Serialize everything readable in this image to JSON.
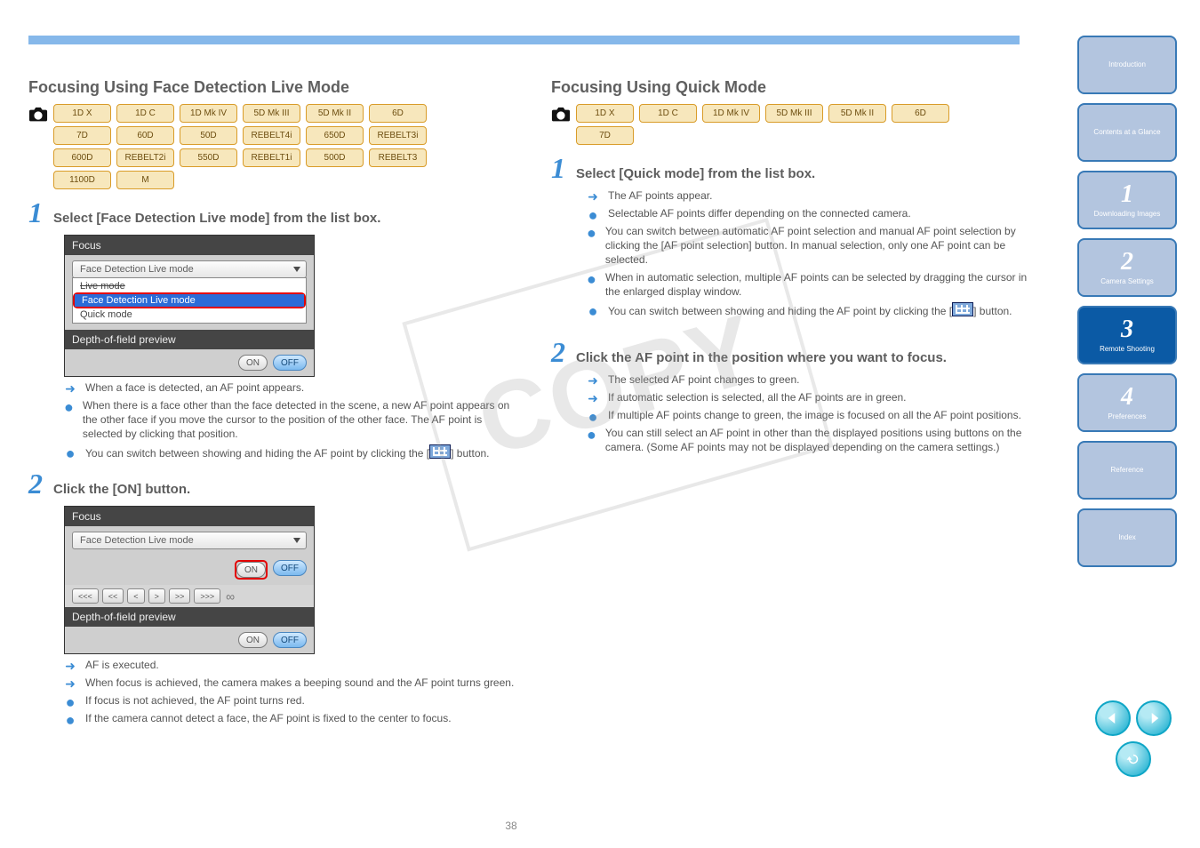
{
  "watermark": "COPY",
  "page_number": "38",
  "top_sidebar": [
    {
      "label": "Introduction"
    },
    {
      "label": "Contents at a Glance"
    },
    {
      "num": "1",
      "label": "Downloading Images"
    },
    {
      "num": "2",
      "label": "Camera Settings"
    },
    {
      "num": "3",
      "label": "Remote Shooting",
      "active": true
    },
    {
      "num": "4",
      "label": "Preferences"
    },
    {
      "label": "Reference"
    },
    {
      "label": "Index"
    }
  ],
  "left": {
    "title": "Focusing Using Face Detection Live Mode",
    "modes": [
      "1D X",
      "1D C",
      "1D Mk IV",
      "5D Mk III",
      "5D Mk II",
      "6D",
      "7D",
      "60D",
      "50D",
      "REBELT4i",
      "650D",
      "REBELT3i",
      "600D",
      "REBELT2i",
      "550D",
      "REBELT1i",
      "500D",
      "REBELT3",
      "1100D",
      "M"
    ],
    "step1": {
      "num": "1",
      "text": "Select [Face Detection Live mode] from the list box.",
      "ui": {
        "head": "Focus",
        "select_value": "Face Detection Live mode",
        "options": [
          "Live mode",
          "Face Detection Live mode",
          "Quick mode"
        ],
        "subhead": "Depth-of-field preview",
        "on": "ON",
        "off": "OFF"
      },
      "arrow1": "When a face is detected, an AF point appears.",
      "bullet1": "When there is a face other than the face detected in the scene, a new AF point appears on the other face if you move the cursor to the position of the other face. The AF point is selected by clicking that position.",
      "bullet2_a": "You can switch between showing and hiding the AF point by clicking the [",
      "bullet2_b": "] button."
    },
    "step2": {
      "num": "2",
      "text": "Click the [ON] button.",
      "ui": {
        "head": "Focus",
        "select_value": "Face Detection Live mode",
        "on": "ON",
        "off": "OFF",
        "nav": [
          "<<<",
          "<<",
          "<",
          ">",
          ">>",
          ">>>"
        ],
        "inf": "∞",
        "subhead": "Depth-of-field preview"
      },
      "arrow1": "AF is executed.",
      "arrow2": "When focus is achieved, the camera makes a beeping sound and the AF point turns green.",
      "bullet1": "If focus is not achieved, the AF point turns red.",
      "bullet2": "If the camera cannot detect a face, the AF point is fixed to the center to focus."
    }
  },
  "right": {
    "title": "Focusing Using Quick Mode",
    "modes": [
      "1D X",
      "1D C",
      "1D Mk IV",
      "5D Mk III",
      "5D Mk II",
      "6D",
      "7D"
    ],
    "step1": {
      "num": "1",
      "text": "Select [Quick mode] from the list box.",
      "arrow1": "The AF points appear.",
      "bullet1": "Selectable AF points differ depending on the connected camera.",
      "bullet2": "You can switch between automatic AF point selection and manual AF point selection by clicking the [AF point selection] button. In manual selection, only one AF point can be selected.",
      "bullet3": "When in automatic selection, multiple AF points can be selected by dragging the cursor in the enlarged display window.",
      "bullet4_a": "You can switch between showing and hiding the AF point by clicking the [",
      "bullet4_b": "] button."
    },
    "step2": {
      "num": "2",
      "text": "Click the AF point in the position where you want to focus.",
      "arrow1": "The selected AF point changes to green.",
      "arrow2": "If automatic selection is selected, all the AF points are in green.",
      "bullet1": "If multiple AF points change to green, the image is focused on all the AF point positions.",
      "bullet2": "You can still select an AF point in other than the displayed positions using buttons on the camera. (Some AF points may not be displayed depending on the camera settings.)"
    }
  }
}
